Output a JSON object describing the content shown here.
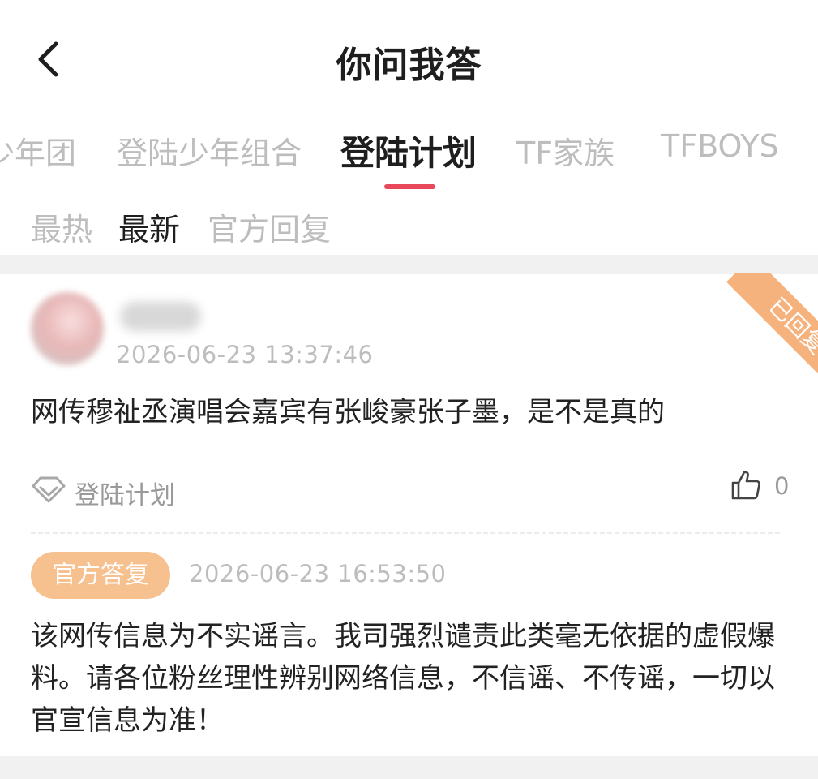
{
  "header": {
    "title": "你问我答"
  },
  "category_tabs": [
    {
      "label": "少年团"
    },
    {
      "label": "登陆少年组合"
    },
    {
      "label": "登陆计划",
      "active": true
    },
    {
      "label": "TF家族"
    },
    {
      "label": "TFBOYS"
    }
  ],
  "sort_tabs": [
    {
      "label": "最热"
    },
    {
      "label": "最新",
      "active": true
    },
    {
      "label": "官方回复"
    }
  ],
  "post": {
    "username": "用户",
    "time": "2026-06-23 13:37:46",
    "status_ribbon": "已回复",
    "question": "网传穆祉丞演唱会嘉宾有张峻豪张子墨，是不是真的",
    "tag": "登陆计划",
    "likes": "0",
    "reply": {
      "badge": "官方答复",
      "time": "2026-06-23 16:53:50",
      "text": "该网传信息为不实谣言。我司强烈谴责此类毫无依据的虚假爆料。请各位粉丝理性辨别网络信息，不信谣、不传谣，一切以官宣信息为准！"
    }
  },
  "colors": {
    "accent": "#e8485a",
    "ribbon": "#f6b27c",
    "badge": "#f7c08f",
    "muted": "#bdbdbd"
  },
  "icons": {
    "back": "chevron-left-icon",
    "tag": "diamond-icon",
    "like": "thumbs-up-icon"
  }
}
